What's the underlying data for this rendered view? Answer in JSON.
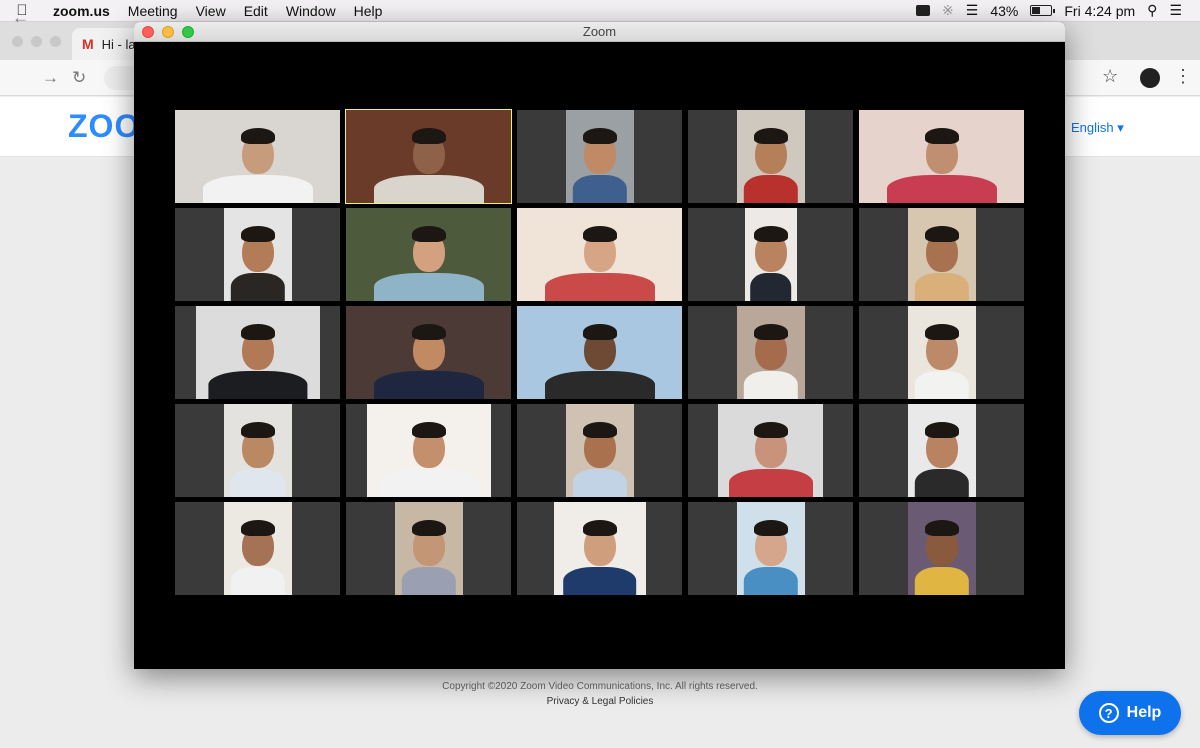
{
  "menubar": {
    "app_name": "zoom.us",
    "items": [
      "Meeting",
      "View",
      "Edit",
      "Window",
      "Help"
    ],
    "battery_percent": "43%",
    "battery_level": 0.43,
    "clock": "Fri 4:24 pm"
  },
  "browser": {
    "tab_title": "Hi - la",
    "language": "English"
  },
  "site": {
    "logo": "ZOO",
    "copyright": "Copyright ©2020 Zoom Video Communications, Inc. All rights reserved.",
    "policies": "Privacy & Legal Policies",
    "help_label": "Help"
  },
  "zoom_window": {
    "title": "Zoom",
    "active_speaker_index": 1,
    "participants": [
      {
        "bg": "#d9d6d2",
        "skin": "#c79c7d",
        "shirt": "#f2f2f2",
        "w": 165
      },
      {
        "bg": "#6b3b2a",
        "skin": "#8d6248",
        "shirt": "#d9d4cc",
        "w": 165
      },
      {
        "bg": "#9aa0a4",
        "skin": "#c08a66",
        "shirt": "#3f5f8f",
        "w": 68
      },
      {
        "bg": "#cfc8bf",
        "skin": "#b57f5a",
        "shirt": "#b8312d",
        "w": 68
      },
      {
        "bg": "#e6d3cc",
        "skin": "#c08f72",
        "shirt": "#c93d52",
        "w": 165
      },
      {
        "bg": "#e4e4e4",
        "skin": "#b37c58",
        "shirt": "#2a2624",
        "w": 68
      },
      {
        "bg": "#4d5a3c",
        "skin": "#d3a180",
        "shirt": "#8fb4c8",
        "w": 165
      },
      {
        "bg": "#f0e3d7",
        "skin": "#d6a585",
        "shirt": "#c94a49",
        "w": 165
      },
      {
        "bg": "#ece9e6",
        "skin": "#b98360",
        "shirt": "#222831",
        "w": 52
      },
      {
        "bg": "#d7c6b0",
        "skin": "#a87250",
        "shirt": "#d9b07a",
        "w": 68
      },
      {
        "bg": "#dcdcdc",
        "skin": "#b27957",
        "shirt": "#1b1d20",
        "w": 124
      },
      {
        "bg": "#4b3a36",
        "skin": "#c28a63",
        "shirt": "#1e2640",
        "w": 165
      },
      {
        "bg": "#a9c7e0",
        "skin": "#6e4a35",
        "shirt": "#2a2a2a",
        "w": 165
      },
      {
        "bg": "#b9a79a",
        "skin": "#a46c4d",
        "shirt": "#f0efeb",
        "w": 68
      },
      {
        "bg": "#ebe6dd",
        "skin": "#bc8a69",
        "shirt": "#f2f2f0",
        "w": 68
      },
      {
        "bg": "#e3e2de",
        "skin": "#bb8864",
        "shirt": "#dfe6ee",
        "w": 68
      },
      {
        "bg": "#f4f1ec",
        "skin": "#c38f6c",
        "shirt": "#f2f2f2",
        "w": 124
      },
      {
        "bg": "#cfc2b3",
        "skin": "#a9714d",
        "shirt": "#c3d3e6",
        "w": 68
      },
      {
        "bg": "#dadada",
        "skin": "#c8937a",
        "shirt": "#c43e44",
        "w": 105
      },
      {
        "bg": "#e9e9e9",
        "skin": "#b98362",
        "shirt": "#2a2a2a",
        "w": 68
      },
      {
        "bg": "#ece9e3",
        "skin": "#a57256",
        "shirt": "#f1f1f1",
        "w": 68
      },
      {
        "bg": "#c7b8a6",
        "skin": "#c39676",
        "shirt": "#9a9fb2",
        "w": 68
      },
      {
        "bg": "#f0ede8",
        "skin": "#cf9e7d",
        "shirt": "#1f3b6b",
        "w": 92
      },
      {
        "bg": "#cfe0ea",
        "skin": "#d6a68c",
        "shirt": "#4a8fc4",
        "w": 68
      },
      {
        "bg": "#6b5a73",
        "skin": "#8a5a3e",
        "shirt": "#e1b542",
        "w": 68
      }
    ]
  }
}
